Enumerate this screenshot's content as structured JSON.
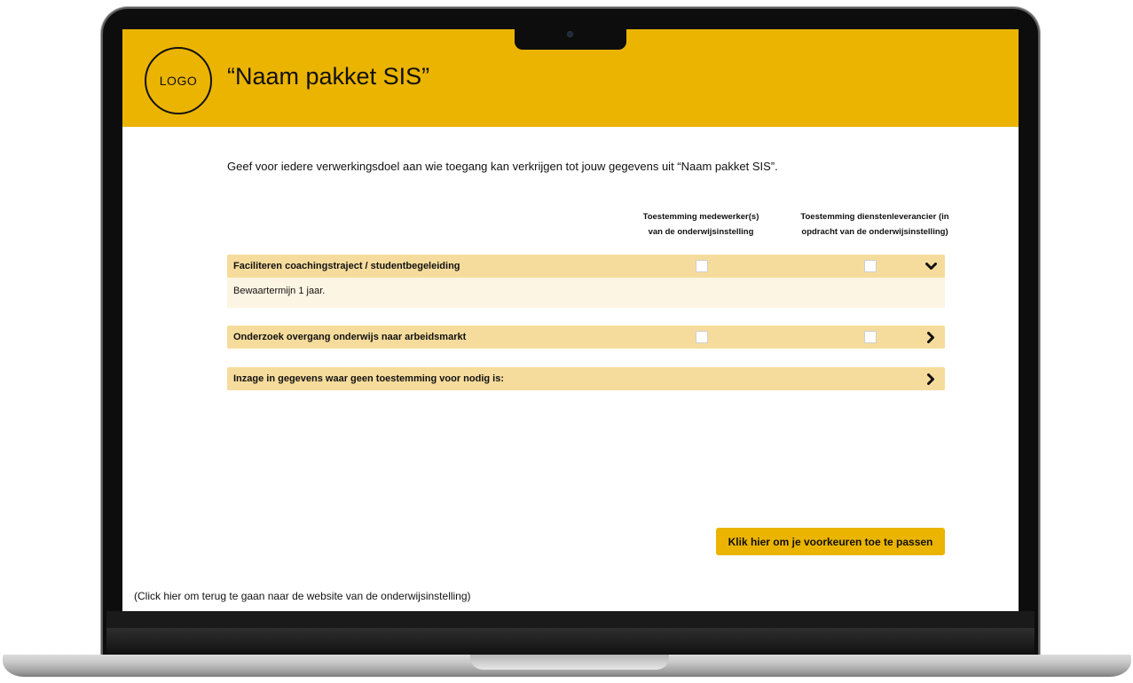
{
  "header": {
    "logo_text": "LOGO",
    "title": "“Naam pakket SIS”"
  },
  "intro": "Geef voor iedere verwerkingsdoel aan wie toegang kan verkrijgen tot jouw gegevens uit “Naam pakket SIS”.",
  "columns": [
    {
      "line1": "Toestemming medewerker(s)",
      "line2": "van de onderwijsinstelling"
    },
    {
      "line1": "Toestemming dienstenleverancier (in",
      "line2": "opdracht van de onderwijsinstelling)"
    }
  ],
  "rows": [
    {
      "label": "Faciliteren coachingstraject / studentbegeleiding",
      "checkbox_employee": false,
      "checkbox_supplier": false,
      "expanded": true,
      "detail": "Bewaartermijn 1 jaar."
    },
    {
      "label": "Onderzoek overgang onderwijs naar arbeidsmarkt",
      "checkbox_employee": false,
      "checkbox_supplier": false,
      "expanded": false
    },
    {
      "label": "Inzage in gegevens waar geen toestemming voor nodig is:",
      "expanded": false
    }
  ],
  "apply_button": "Klik hier om je voorkeuren toe te passen",
  "back_link": "(Click hier om terug te gaan naar de website van de onderwijsinstelling)",
  "colors": {
    "accent": "#ebb400",
    "row_bg": "#f6dc9c",
    "detail_bg": "#fdf5e3"
  },
  "icons": {
    "expanded": "chevron-down-icon",
    "collapsed": "chevron-right-icon"
  }
}
